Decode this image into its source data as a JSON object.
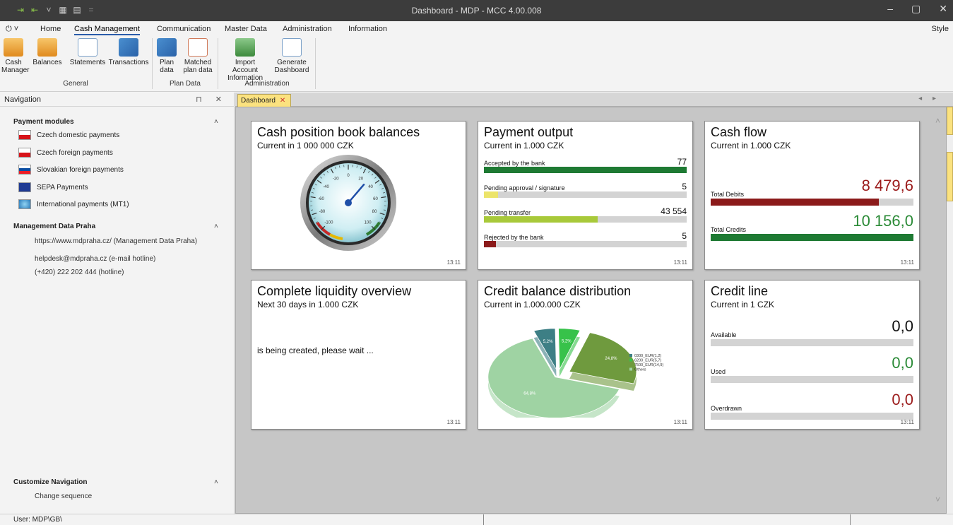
{
  "window": {
    "title": "Dashboard - MDP - MCC 4.00.008",
    "controls": [
      "–",
      "▢",
      "✕"
    ]
  },
  "menu": {
    "power": "⏻ ˅",
    "items": [
      "Home",
      "Cash Management",
      "Communication",
      "Master Data",
      "Administration",
      "Information"
    ],
    "active": "Cash Management",
    "style": "Style"
  },
  "ribbon": {
    "general": {
      "label": "General",
      "buttons": [
        {
          "l1": "Cash",
          "l2": "Manager"
        },
        {
          "l1": "Balances",
          "l2": ""
        },
        {
          "l1": "Statements",
          "l2": ""
        },
        {
          "l1": "Transactions",
          "l2": ""
        }
      ]
    },
    "plan": {
      "label": "Plan Data",
      "buttons": [
        {
          "l1": "Plan",
          "l2": "data"
        },
        {
          "l1": "Matched",
          "l2": "plan data"
        }
      ]
    },
    "admin": {
      "label": "Administration",
      "buttons": [
        {
          "l1": "Import Account",
          "l2": "Information"
        },
        {
          "l1": "Generate",
          "l2": "Dashboard"
        }
      ]
    }
  },
  "nav": {
    "title": "Navigation",
    "controls": "⊓ ✕",
    "payment_modules": {
      "title": "Payment modules",
      "items": [
        "Czech domestic payments",
        "Czech foreign payments",
        "Slovakian foreign payments",
        "SEPA Payments",
        "International payments (MT1)"
      ]
    },
    "mdp": {
      "title": "Management Data Praha",
      "lines": [
        "https://www.mdpraha.cz/ (Management Data Praha)",
        "helpdesk@mdpraha.cz (e-mail hotline)",
        "(+420) 222 202 444 (hotline)"
      ]
    },
    "customize": {
      "title": "Customize Navigation",
      "item": "Change sequence"
    }
  },
  "tabs": {
    "doc_tab": "Dashboard",
    "close": "✕",
    "arrows": "◂ ▸"
  },
  "cards": {
    "cash_position": {
      "title": "Cash position book balances",
      "subtitle": "Current in 1 000 000 CZK",
      "time": "13:11",
      "gauge_ticks": [
        "-100",
        "-80",
        "-60",
        "-40",
        "-20",
        "0",
        "20",
        "40",
        "60",
        "80",
        "100"
      ],
      "needle_value": 30
    },
    "payment_output": {
      "title": "Payment output",
      "subtitle": "Current in 1.000 CZK",
      "time": "13:11",
      "rows": [
        {
          "label": "Accepted by the bank",
          "value": "77",
          "fill": 1.0,
          "color": "#1e7a33"
        },
        {
          "label": "Pending approval / signature",
          "value": "5",
          "fill": 0.07,
          "color": "#ece46a"
        },
        {
          "label": "Pending transfer",
          "value": "43 554",
          "fill": 0.56,
          "color": "#a8c93a"
        },
        {
          "label": "Rejected by the bank",
          "value": "5",
          "fill": 0.06,
          "color": "#8b1a1a"
        }
      ]
    },
    "cash_flow": {
      "title": "Cash flow",
      "subtitle": "Current in 1.000 CZK",
      "time": "13:11",
      "rows": [
        {
          "label": "Total Debits",
          "value": "8 479,6",
          "fill": 0.83,
          "color": "#8b1a1a",
          "text_color": "#9b1b1b"
        },
        {
          "label": "Total Credits",
          "value": "10 156,0",
          "fill": 1.0,
          "color": "#1e7a33",
          "text_color": "#2a8a36"
        }
      ]
    },
    "liquidity": {
      "title": "Complete liquidity overview",
      "subtitle": "Next 30 days in 1.000 CZK",
      "message": "is being created, please wait ...",
      "time": "13:11"
    },
    "credit_balance": {
      "title": "Credit balance distribution",
      "subtitle": "Current in 1.000.000 CZK",
      "time": "13:11"
    },
    "credit_line": {
      "title": "Credit line",
      "subtitle": "Current in 1 CZK",
      "time": "13:11",
      "rows": [
        {
          "label": "Available",
          "value": "0,0",
          "text_color": "#111111"
        },
        {
          "label": "Used",
          "value": "0,0",
          "text_color": "#2a8a36"
        },
        {
          "label": "Overdrawn",
          "value": "0,0",
          "text_color": "#9b1b1b"
        }
      ]
    }
  },
  "chart_data": {
    "type": "pie",
    "title": "Credit balance distribution",
    "subtitle": "Current in 1.000.000 CZK",
    "categories": [
      "0300_EUR(1,2)",
      "6200_EUR(5,7)",
      "7500_EUR(14,9)",
      "Others"
    ],
    "values": [
      5.2,
      5.2,
      24.8,
      64.8
    ],
    "value_labels": [
      "5,2%",
      "5,2%",
      "24,8%",
      "64,8%"
    ],
    "colors": [
      "#3d7f85",
      "#37c24a",
      "#6f9a3e",
      "#9fd3a3"
    ],
    "legend": "right"
  },
  "status": {
    "user": "User: MDP\\GB\\"
  }
}
